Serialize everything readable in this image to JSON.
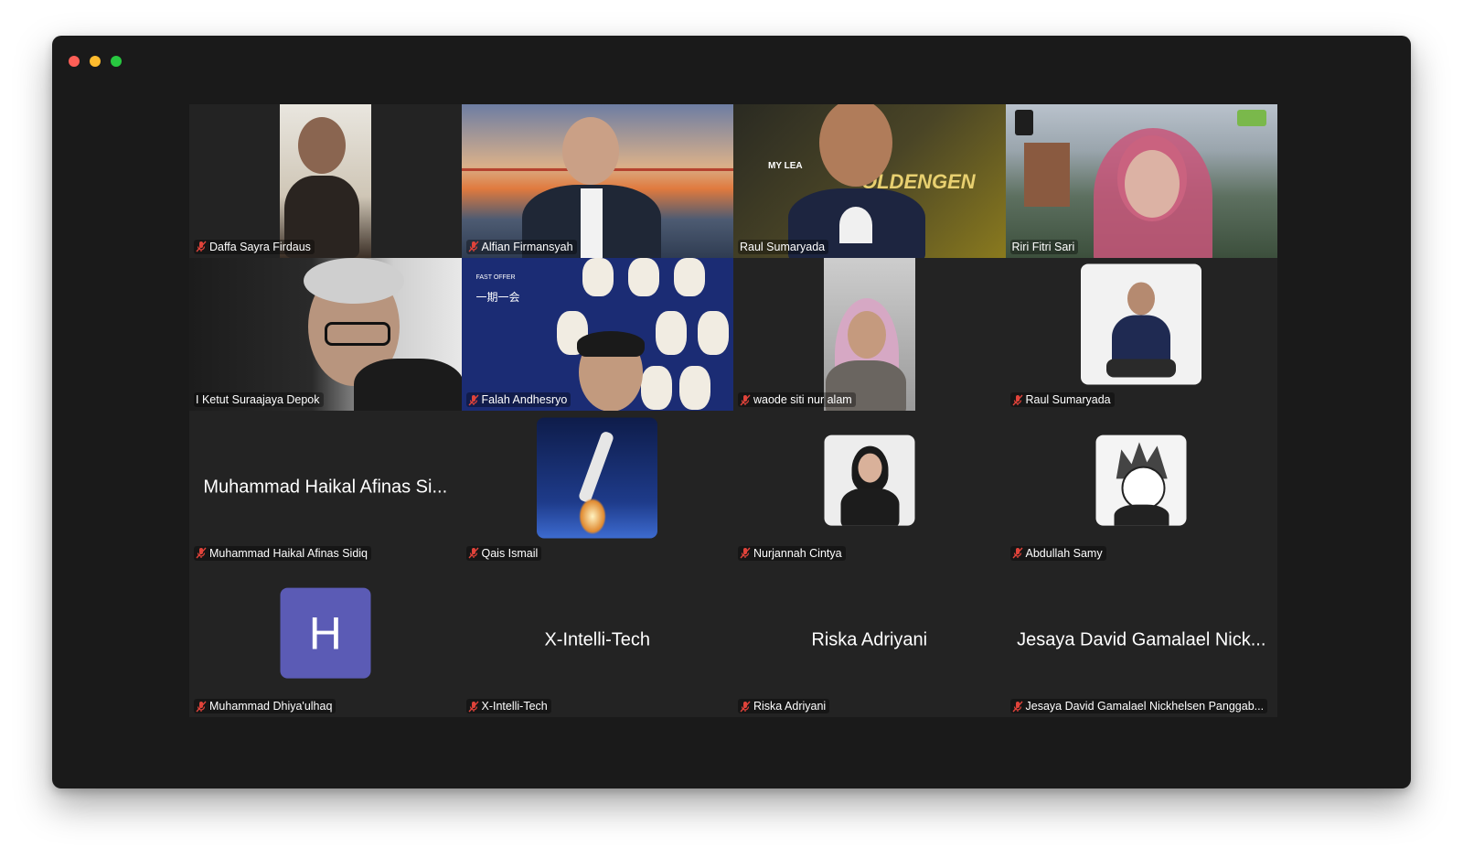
{
  "window": {
    "traffic_lights": [
      {
        "name": "close",
        "color": "#fe5f57"
      },
      {
        "name": "minimize",
        "color": "#febc2e"
      },
      {
        "name": "zoom",
        "color": "#28c840"
      }
    ]
  },
  "participants": [
    {
      "name": "Daffa Sayra Firdaus",
      "muted": true
    },
    {
      "name": "Alfian Firmansyah",
      "muted": true
    },
    {
      "name": "Raul Sumaryada",
      "muted": false,
      "active_speaker": true,
      "bg_text": "MY LEA",
      "bg_text2": "OLDENGEN"
    },
    {
      "name": "Riri Fitri Sari",
      "muted": false
    },
    {
      "name": "I Ketut Suraajaya Depok",
      "muted": false
    },
    {
      "name": "Falah Andhesryo",
      "muted": true,
      "bg_text": "FAST OFFER",
      "bg_text2": "一期一会"
    },
    {
      "name": "waode siti nur alam",
      "muted": true
    },
    {
      "name": "Raul Sumaryada",
      "muted": true
    },
    {
      "name": "Muhammad Haikal Afinas Sidiq",
      "display": "Muhammad Haikal Afinas Si...",
      "muted": true
    },
    {
      "name": "Qais Ismail",
      "muted": true
    },
    {
      "name": "Nurjannah Cintya",
      "muted": true
    },
    {
      "name": "Abdullah Samy",
      "muted": true
    },
    {
      "name": "Muhammad Dhiya'ulhaq",
      "avatar_letter": "H",
      "muted": true
    },
    {
      "name": "X-Intelli-Tech",
      "display": "X-Intelli-Tech",
      "muted": true
    },
    {
      "name": "Riska Adriyani",
      "display": "Riska Adriyani",
      "muted": true
    },
    {
      "name": "Jesaya David Gamalael Nickhelsen Panggab...",
      "display": "Jesaya David Gamalael Nick...",
      "muted": true
    }
  ],
  "colors": {
    "active_border": "#39c23a",
    "muted_icon": "#e0433a",
    "window_bg": "#1a1a1a",
    "tile_bg": "#232323",
    "avatar_h": "#5b5bb5"
  }
}
